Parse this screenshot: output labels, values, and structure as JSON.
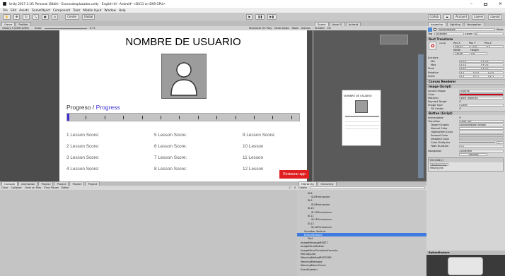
{
  "window": {
    "title": "Unity 2017.3.1f1 Personal (64bit) - Escenadesplazadas.unity - English-UI - Android* <DX11 on DX9 GPU>",
    "minimize": "–",
    "close": "×"
  },
  "menu": [
    "File",
    "Edit",
    "Assets",
    "GameObject",
    "Component",
    "Tools",
    "Mobile Input",
    "Window",
    "Help"
  ],
  "toolbar": {
    "center_label": "Center",
    "global_label": "Global",
    "collab_label": "Collab",
    "account_label": "Account",
    "layers_label": "Layers",
    "layout_label": "Layout"
  },
  "game_view": {
    "tab_game": "Game",
    "tab_profiler": "Profiler",
    "resolution": "Galaxy S (800x1280)",
    "scale_label": "Scale",
    "scale_value": "0.75",
    "maximize_on_play": "Maximize On Play",
    "mute_audio": "Mute Audio",
    "stats": "Stats",
    "gizmos": "Gizmos"
  },
  "app": {
    "username": "NOMBRE DE USUARIO",
    "progress_es": "Progreso",
    "progress_sep": "/",
    "progress_en": "Progress",
    "progress_value": 0.01,
    "scores_col1": [
      "1 Lesson Score:",
      "2 Lesson Score:",
      "3 Lesson Score:",
      "4 Lesson Score:"
    ],
    "scores_col2": [
      "5 Lesson Score:",
      "6 Lesson Score:",
      "7 Lesson Score:",
      "8 Lesson Score:"
    ],
    "scores_col3": [
      "9 Lesson Score:",
      "10 Lesson",
      "11 Lesson",
      "12 Lesson"
    ],
    "restore_button": "Restaurar app",
    "accent_color": "#3f2fd6",
    "button_color": "#e02020"
  },
  "scene_view": {
    "tab_scene": "Scene",
    "tab_asset_store": "Asset S",
    "tab_animator": "Animat",
    "shaded": "Shaded",
    "mode_2d": "2D",
    "username_small": "NOMBRE DE USUARIO"
  },
  "inspector": {
    "tab_inspector": "Inspector",
    "tab_lighting": "Lighting",
    "tab_navigation": "Navigation",
    "object_name": "ButtonRestore",
    "static_label": "Static",
    "tag_label": "Tag",
    "tag_value": "Untagged",
    "layer_label": "Layer",
    "layer_value": "UI",
    "rect_transform": "Rect Transform",
    "anchor_label": "center",
    "pos_x_label": "Pos X",
    "pos_y_label": "Pos Y",
    "pos_z_label": "Pos Z",
    "pos_x": "344.03",
    "pos_y": "-210",
    "pos_z": "0",
    "width_label": "Width",
    "height_label": "Height",
    "width": "136.96",
    "height": "30",
    "anchors": "Anchors",
    "min": "Min",
    "max": "Max",
    "pivot": "Pivot",
    "min_x": "X 0.5",
    "min_y": "Y 0.5",
    "max_x": "X 0.5",
    "max_y": "Y 0.5",
    "pivot_x": "X 0.5",
    "pivot_y": "Y 0.5",
    "rotation": "Rotation",
    "scale": "Scale",
    "rot_x": "X 0",
    "rot_y": "Y 0",
    "rot_z": "Z 0",
    "scale_x": "X 1",
    "scale_y": "Y 1",
    "scale_z": "Z 1",
    "canvas_renderer": "Canvas Renderer",
    "image_script": "Image (Script)",
    "source_image": "Source Image",
    "source_image_value": "UISprite",
    "color": "Color",
    "material": "Material",
    "material_value": "None (Material)",
    "raycast_target": "Raycast Target",
    "image_type": "Image Type",
    "image_type_value": "Sliced",
    "fill_center": "Fill Center",
    "button_script": "Button (Script)",
    "interactable": "Interactable",
    "transition": "Transition",
    "transition_value": "Color Tint",
    "target_graphic": "Target Graphic",
    "target_graphic_value": "ButtonRestore (Image)",
    "normal_color": "Normal Color",
    "highlighted_color": "Highlighted Color",
    "pressed_color": "Pressed Color",
    "disabled_color": "Disabled Color",
    "color_multiplier": "Color Multiplier",
    "color_multiplier_value": "1",
    "fade_duration": "Fade Duration",
    "fade_duration_value": "0.1",
    "navigation": "Navigation",
    "navigation_value": "Automatic",
    "visualize": "Visualize",
    "on_click": "On Click ()",
    "on_click_value": "Runtime Only",
    "missing": "Missing (Ob",
    "image_color": "#d0021b"
  },
  "console": {
    "tab_console": "Console",
    "tab_animation": "Animation",
    "tab_project1": "Project",
    "tab_project2": "Project",
    "tab_project3": "Project",
    "tab_project4": "Project",
    "clear": "Clear",
    "collapse": "Collapse",
    "clear_on_play": "Clear on Play",
    "error_pause": "Error Pause",
    "editor": "Editor",
    "count": "0"
  },
  "hierarchy": {
    "tab1": "Hierarchy",
    "tab2": "Hierarchy",
    "create": "Create",
    "items": [
      {
        "label": "SL8",
        "indent": 3
      },
      {
        "label": "SL8Puntuacion",
        "indent": 4
      },
      {
        "label": "SL9",
        "indent": 3
      },
      {
        "label": "SL9Puntuacion",
        "indent": 4
      },
      {
        "label": "SL10",
        "indent": 3
      },
      {
        "label": "SL10Puntuacion",
        "indent": 4
      },
      {
        "label": "SL11",
        "indent": 3
      },
      {
        "label": "SL11Puntuacion",
        "indent": 4
      },
      {
        "label": "SL12",
        "indent": 3
      },
      {
        "label": "SL12Puntuacion",
        "indent": 4
      },
      {
        "label": "Scrollbar Vertical",
        "indent": 2
      },
      {
        "label": "ButtonRestore",
        "indent": 2
      },
      {
        "label": "Text",
        "indent": 3
      },
      {
        "label": "ImageMessageRESET",
        "indent": 1
      },
      {
        "label": "ImageMenuButton",
        "indent": 1
      },
      {
        "label": "ImageMenuFirmationFormula",
        "indent": 1
      },
      {
        "label": "MenuAyuda",
        "indent": 1
      },
      {
        "label": "WarningMeltedRESTORE",
        "indent": 1
      },
      {
        "label": "WarningMessage",
        "indent": 1
      },
      {
        "label": "WarningMenuCheck",
        "indent": 1
      },
      {
        "label": "EventSystem",
        "indent": 1
      }
    ],
    "selected_index": 11
  },
  "preview": {
    "label": "ButtonRestore"
  }
}
